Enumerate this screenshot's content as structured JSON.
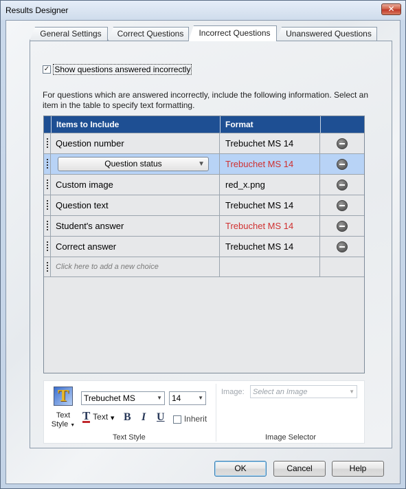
{
  "window": {
    "title": "Results Designer",
    "close_glyph": "✕"
  },
  "tabs": [
    "General Settings",
    "Correct Questions",
    "Incorrect Questions",
    "Unanswered Questions"
  ],
  "active_tab": "Incorrect Questions",
  "show_checkbox": {
    "label": "Show questions answered incorrectly",
    "checked": true,
    "check_glyph": "✓"
  },
  "description": "For questions which are answered incorrectly, include the following information. Select an item in the table to specify text formatting.",
  "table": {
    "headers": [
      "Items to Include",
      "Format"
    ],
    "rows": [
      {
        "item": "Question number",
        "format": "Trebuchet MS 14",
        "format_red": false
      },
      {
        "item": "Question status",
        "format": "Trebuchet MS 14",
        "format_red": true,
        "selected": true,
        "editing": true
      },
      {
        "item": "Custom image",
        "format": "red_x.png",
        "format_red": false
      },
      {
        "item": "Question text",
        "format": "Trebuchet MS 14",
        "format_red": false
      },
      {
        "item": "Student's answer",
        "format": "Trebuchet MS 14",
        "format_red": true
      },
      {
        "item": "Correct answer",
        "format": "Trebuchet MS 14",
        "format_red": false
      }
    ],
    "add_row_text": "Click here to add a new choice"
  },
  "text_style": {
    "icon_label_1": "Text",
    "icon_label_2": "Style",
    "font": "Trebuchet MS",
    "size": "14",
    "text_color_label": "Text",
    "bold": "B",
    "italic": "I",
    "underline": "U",
    "inherit_label": "Inherit",
    "group_label": "Text Style"
  },
  "image_selector": {
    "label": "Image:",
    "placeholder": "Select an Image",
    "group_label": "Image Selector"
  },
  "buttons": {
    "ok": "OK",
    "cancel": "Cancel",
    "help": "Help"
  },
  "colors": {
    "header_blue": "#1e4f93",
    "selected_row": "#b8d3f6",
    "red_text": "#d03030"
  }
}
